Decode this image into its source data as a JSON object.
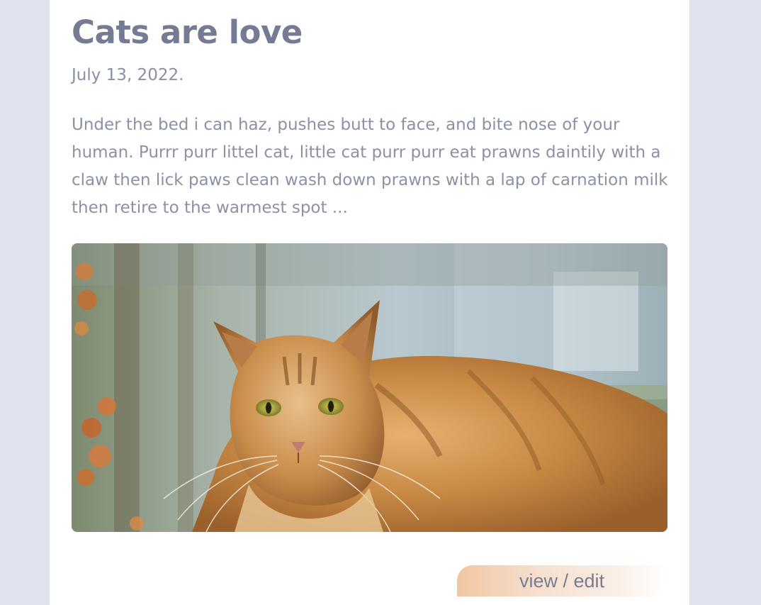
{
  "post": {
    "title": "Cats are love",
    "date": "July 13, 2022.",
    "excerpt": "Under the bed i can haz, pushes butt to face, and bite nose of your human. Purrr purr littel cat, little cat purr purr eat prawns daintily with a claw then lick paws clean wash down prawns with a lap of carnation milk then retire to the warmest spot ...",
    "image": {
      "icon": "cat-photo"
    },
    "action_label": "view / edit"
  },
  "colors": {
    "page_background": "#e0e3ee",
    "card_background": "#ffffff",
    "title": "#757b92",
    "body_text": "#8c91a6",
    "button_gradient_start": "#f0c6a2"
  }
}
